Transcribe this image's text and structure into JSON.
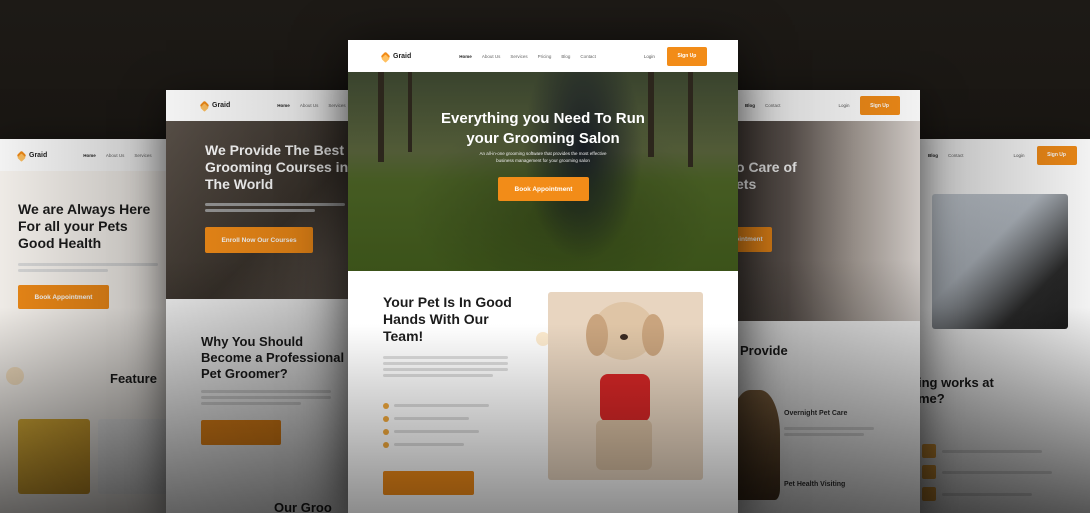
{
  "brand": {
    "name": "Graid",
    "accent": "#f28c18"
  },
  "center": {
    "nav": {
      "links": [
        "Home",
        "About Us",
        "Services",
        "Pricing",
        "Blog",
        "Contact"
      ],
      "login": "Login",
      "signup": "Sign Up"
    },
    "hero": {
      "title_line1": "Everything you Need To Run",
      "title_line2": "your Grooming Salon",
      "subtitle_line1": "An all-in-one grooming software that provides the most effective",
      "subtitle_line2": "business management for your grooming salon",
      "cta": "Book Appointment"
    },
    "section": {
      "title_line1": "Your Pet Is In Good",
      "title_line2": "Hands With Our",
      "title_line3": "Team!"
    }
  },
  "left2": {
    "nav": {
      "links": [
        "Home",
        "About Us",
        "Services"
      ]
    },
    "hero": {
      "title_line1": "We Provide The Best",
      "title_line2": "Grooming Courses in",
      "title_line3": "The World",
      "cta": "Enroll Now Our Courses"
    },
    "section": {
      "title_line1": "Why You Should",
      "title_line2": "Become a Professional",
      "title_line3": "Pet Groomer?"
    },
    "bottom_title": "Our Groo"
  },
  "left1": {
    "nav": {
      "links": [
        "Home",
        "About Us",
        "Services"
      ]
    },
    "hero": {
      "title_line1": "We are Always Here",
      "title_line2": "For all your Pets",
      "title_line3": "Good Health",
      "cta": "Book Appointment"
    },
    "section_title": "Feature"
  },
  "right2": {
    "nav": {
      "links": [
        "Blog",
        "Contact"
      ],
      "login": "Login",
      "signup": "Sign Up"
    },
    "hero": {
      "title_line1": "o Care of",
      "title_line2": "ets",
      "cta": "pointment"
    },
    "section_title": "Provide",
    "services": [
      "Overnight Pet Care",
      "Pet Health Visiting"
    ]
  },
  "right1": {
    "nav": {
      "links": [
        "Blog",
        "Contact"
      ],
      "login": "Login",
      "signup": "Sign Up"
    },
    "section": {
      "title_line1": "ing works at",
      "title_line2": "me?"
    }
  }
}
